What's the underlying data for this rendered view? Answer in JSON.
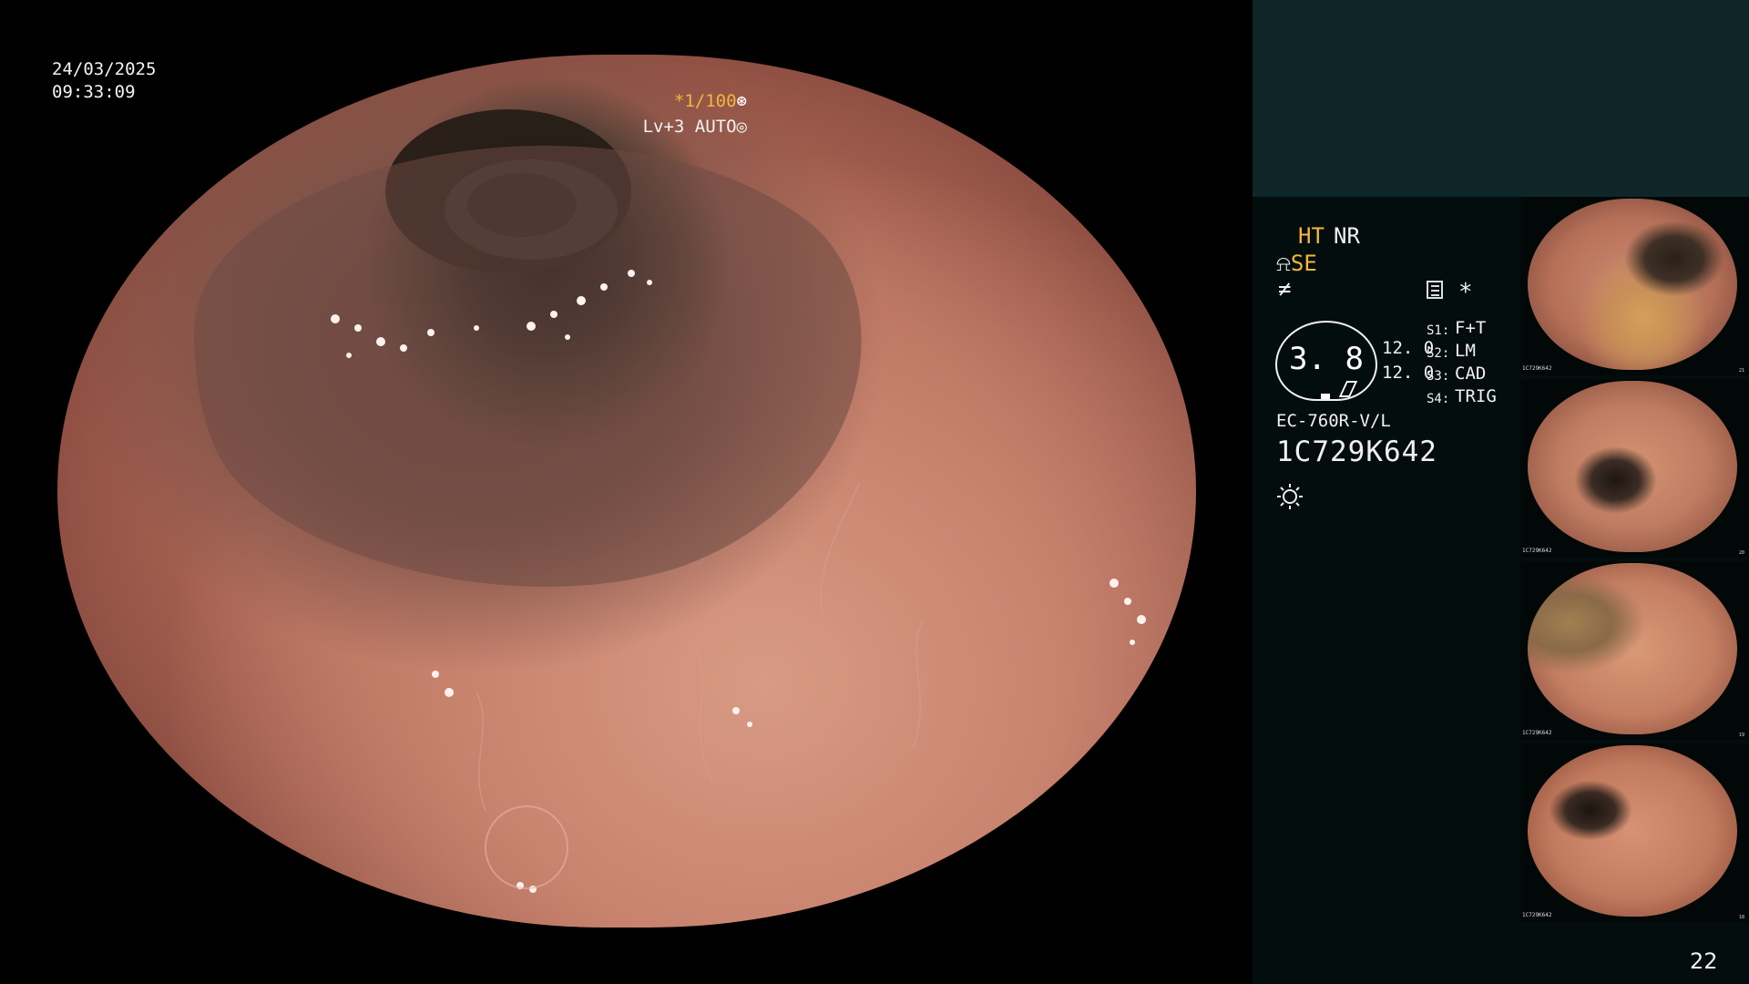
{
  "main": {
    "date": "24/03/2025",
    "time": "09:33:09",
    "shutter": "*1/100",
    "level": "Lv+3 AUTO"
  },
  "panel": {
    "ht_label": "HT",
    "nr_label": "NR",
    "se_prefix": "⍾",
    "se_label": "SE",
    "f_label": "≠",
    "star_label": "*",
    "gauge_value": "3. 8",
    "gauge_right_1": "12. 0",
    "gauge_right_2": "12. 0",
    "switches": [
      {
        "key": "S1:",
        "value": "F+T"
      },
      {
        "key": "S2:",
        "value": "LM"
      },
      {
        "key": "S3:",
        "value": "CAD"
      },
      {
        "key": "S4:",
        "value": "TRIG"
      }
    ],
    "scope_model": "EC-760R-V/L",
    "scope_serial": "1C729K642"
  },
  "thumbnails": [
    {
      "id": "1C729K642",
      "index": "21"
    },
    {
      "id": "1C729K642",
      "index": "20"
    },
    {
      "id": "1C729K642",
      "index": "19"
    },
    {
      "id": "1C729K642",
      "index": "18"
    }
  ],
  "page_number": "22",
  "colors": {
    "accent": "#f3b63a",
    "panel_top": "#0e2628",
    "panel_bg": "#040d0d"
  }
}
